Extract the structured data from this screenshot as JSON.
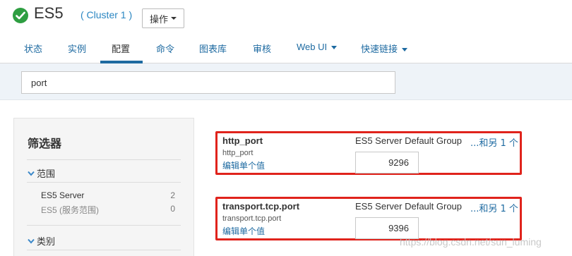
{
  "header": {
    "service_name": "ES5",
    "cluster_label": "( Cluster 1 )",
    "actions_label": "操作",
    "status_color": "#2e9e41"
  },
  "tabs": [
    {
      "label": "状态",
      "active": false
    },
    {
      "label": "实例",
      "active": false
    },
    {
      "label": "配置",
      "active": true
    },
    {
      "label": "命令",
      "active": false
    },
    {
      "label": "图表库",
      "active": false
    },
    {
      "label": "审核",
      "active": false
    },
    {
      "label": "Web UI",
      "active": false,
      "dropdown": true
    },
    {
      "label": "快速链接",
      "active": false,
      "dropdown": true
    }
  ],
  "search": {
    "value": "port"
  },
  "filters": {
    "title": "筛选器",
    "scope": {
      "label": "范围",
      "items": [
        {
          "name": "ES5 Server",
          "count": "2"
        },
        {
          "name": "ES5 (服务范围)",
          "count": "0"
        }
      ]
    },
    "category": {
      "label": "类别"
    }
  },
  "configs": [
    {
      "display_name": "http_port",
      "key": "http_port",
      "edit_label": "编辑单个值",
      "group": "ES5 Server Default Group",
      "more": "...和另 1 个",
      "value": "9296"
    },
    {
      "display_name": "transport.tcp.port",
      "key": "transport.tcp.port",
      "edit_label": "编辑单个值",
      "group": "ES5 Server Default Group",
      "more": "...和另 1 个",
      "value": "9396"
    }
  ],
  "watermark": "https://blog.csdn.net/sun_luming",
  "colors": {
    "link": "#1d6aa1",
    "highlight_border": "#e0231c",
    "search_strip": "#eef3f8"
  }
}
